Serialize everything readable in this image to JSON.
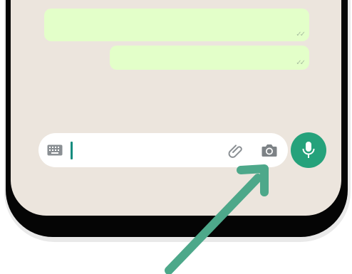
{
  "chat": {
    "bubbles": [
      {
        "status_icon": "double-check-icon",
        "status_text": "✓✓"
      },
      {
        "status_icon": "double-check-icon",
        "status_text": "✓✓"
      }
    ]
  },
  "composer": {
    "input_value": "",
    "keyboard_icon": "keyboard-icon",
    "attach_icon": "paperclip-icon",
    "camera_icon": "camera-icon",
    "send_icon": "microphone-icon"
  },
  "colors": {
    "chat_background": "#ece5dd",
    "outgoing_bubble": "#e3ffc9",
    "accent": "#25a27b",
    "caret": "#128c7e",
    "annotation_arrow": "#4da88a"
  },
  "annotation": {
    "type": "arrow",
    "points_to": "camera-icon"
  }
}
